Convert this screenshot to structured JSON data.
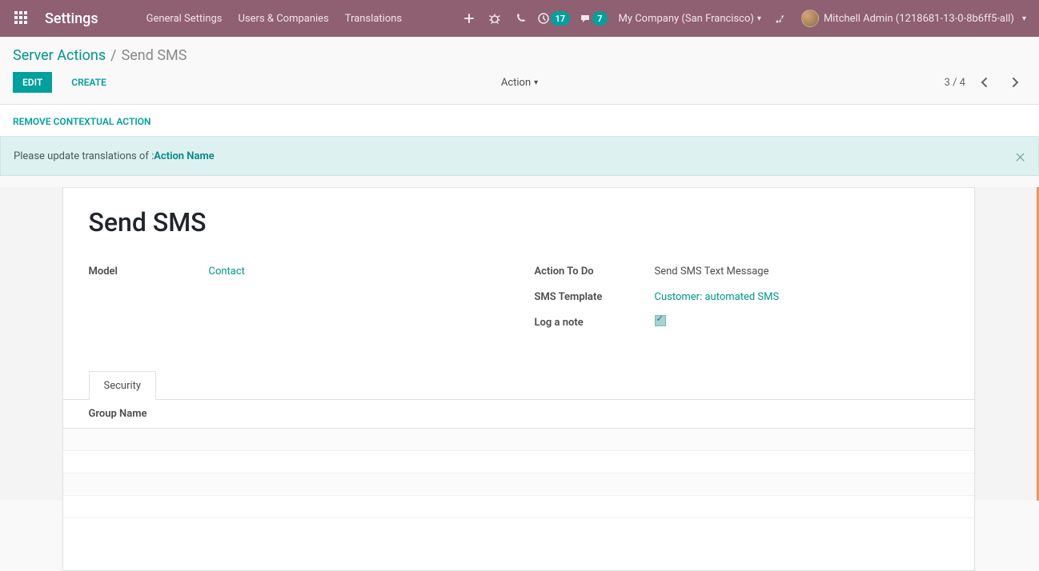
{
  "navbar": {
    "brand": "Settings",
    "items": [
      "General Settings",
      "Users & Companies",
      "Translations"
    ],
    "activity_count": "17",
    "msg_count": "7",
    "company": "My Company (San Francisco)",
    "user": "Mitchell Admin (1218681-13-0-8b6ff5-all)"
  },
  "breadcrumb": {
    "parent": "Server Actions",
    "current": "Send SMS"
  },
  "controls": {
    "edit": "Edit",
    "create": "Create",
    "action": "Action",
    "pager": "3 / 4"
  },
  "statusbar": {
    "remove": "Remove Contextual Action"
  },
  "alert": {
    "prefix": "Please update translations of : ",
    "link": "Action Name"
  },
  "form": {
    "title": "Send SMS",
    "left": {
      "model_label": "Model",
      "model_value": "Contact"
    },
    "right": {
      "action_label": "Action To Do",
      "action_value": "Send SMS Text Message",
      "template_label": "SMS Template",
      "template_value": "Customer: automated SMS",
      "lognote_label": "Log a note",
      "lognote_checked": true
    },
    "tabs": [
      "Security"
    ],
    "columns": [
      "Group Name"
    ]
  }
}
